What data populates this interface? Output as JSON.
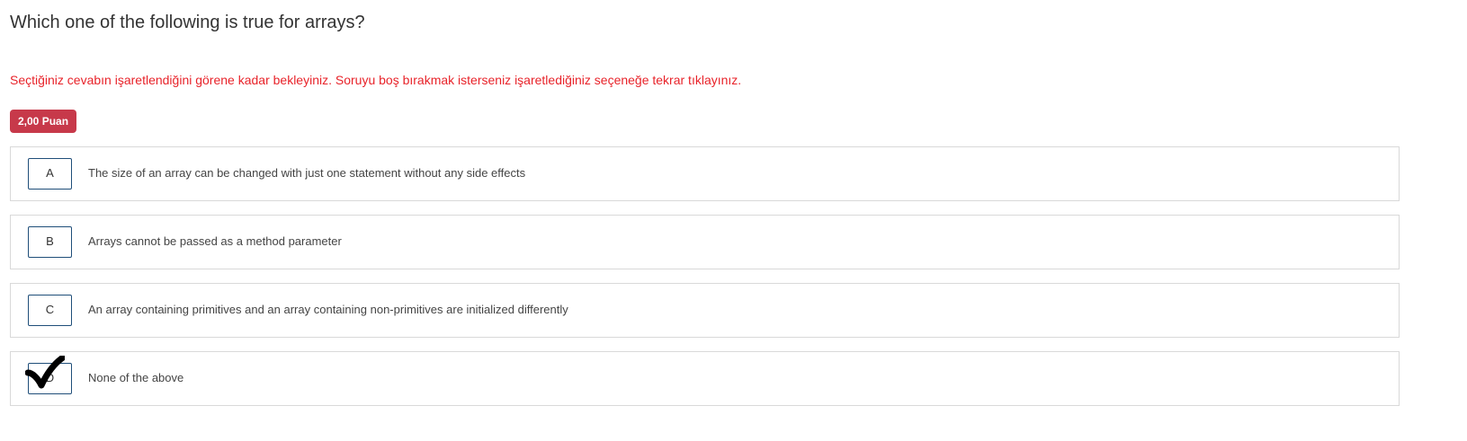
{
  "question": {
    "text": "Which one of the following is true for arrays?"
  },
  "warning": {
    "text": "Seçtiğiniz cevabın işaretlendiğini görene kadar bekleyiniz. Soruyu boş bırakmak isterseniz işaretlediğiniz seçeneğe tekrar tıklayınız.",
    "color": "#e8232a"
  },
  "points": {
    "label": "2,00 Puan",
    "color": "#c7394a"
  },
  "options": [
    {
      "letter": "A",
      "text": "The size of an array can be changed with just one statement without any side effects",
      "selected": false
    },
    {
      "letter": "B",
      "text": "Arrays cannot be passed as a method parameter",
      "selected": false
    },
    {
      "letter": "C",
      "text": "An array containing primitives and an array containing non-primitives are initialized differently",
      "selected": false
    },
    {
      "letter": "D",
      "text": "None of the above",
      "selected": true
    }
  ],
  "check_icon": "check-mark-icon"
}
